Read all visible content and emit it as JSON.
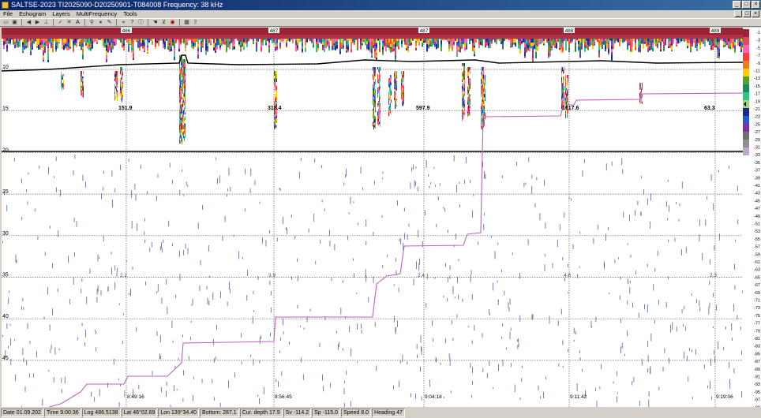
{
  "window": {
    "title": "SALTSE-2023  TI2025090-D20250901-T084008  Frequency: 38 kHz",
    "buttons": [
      "_",
      "□",
      "×"
    ]
  },
  "menu": {
    "items": [
      "File",
      "Echogram",
      "Layers",
      "MultiFrequency",
      "Tools"
    ],
    "mdi_buttons": [
      "_",
      "□",
      "×"
    ]
  },
  "toolbar": {
    "icons": [
      "open-icon",
      "save-icon",
      "back-icon",
      "forward-icon",
      "measure-icon",
      "check-icon",
      "layer-tool-icon",
      "letter-a-icon",
      "zoom-icon",
      "color-icon",
      "pen-icon",
      "pan-icon",
      "help-icon",
      "info-icon",
      "hand-icon",
      "bottom-icon",
      "eye-icon",
      "grid-icon",
      "export-icon"
    ]
  },
  "echogram": {
    "depth_labels": [
      "10",
      "15",
      "20",
      "25",
      "30",
      "35",
      "40",
      "45"
    ],
    "log_labels": [
      "486",
      "487",
      "487",
      "488",
      "489"
    ],
    "value_labels_top": [
      "151.9",
      "318.4",
      "597.9",
      "1017.6",
      "63.3"
    ],
    "value_labels_mid": [
      "2.2",
      "3.9",
      "2.4",
      "4.8",
      "2.3"
    ],
    "time_labels": [
      "8:49:16",
      "8:56:45",
      "9:04:18",
      "9:11:42",
      "9:19:06"
    ],
    "colors": {
      "top_band": "#9b2335",
      "integration_line": "#c060c0",
      "bottom_line": "#000000",
      "noise": "#1a2a80"
    }
  },
  "scale": {
    "labels": [
      "-1",
      "-3",
      "-5",
      "-7",
      "-9",
      "-11",
      "-13",
      "-15",
      "-17",
      "-19",
      "-21",
      "-23",
      "-25",
      "-27",
      "-29",
      "-31",
      "-33",
      "-35",
      "-37",
      "-39",
      "-41",
      "-43",
      "-45",
      "-47",
      "-49",
      "-51",
      "-53",
      "-55",
      "-57",
      "-59",
      "-61",
      "-63",
      "-65",
      "-67",
      "-69",
      "-71",
      "-73",
      "-75",
      "-77",
      "-79",
      "-81",
      "-83",
      "-85",
      "-87",
      "-89",
      "-91",
      "-93",
      "-95",
      "-97",
      "-99"
    ],
    "colors": [
      "#9b2335",
      "#e04a5a",
      "#ff66aa",
      "#ff3b3b",
      "#f07a20",
      "#ffcc00",
      "#58a028",
      "#1c8a5a",
      "#30c88a",
      "#a0d870",
      "#1a2a9a",
      "#2a5ad0",
      "#8030a0",
      "#707070",
      "#909090",
      "#c0a8c8"
    ]
  },
  "status": {
    "fields": [
      {
        "label": "Date",
        "value": "01.09.202"
      },
      {
        "label": "Time",
        "value": "9:00:36"
      },
      {
        "label": "Log",
        "value": "486.5138"
      },
      {
        "label": "Lat",
        "value": "46°02.69"
      },
      {
        "label": "Lon",
        "value": "139°34.40"
      },
      {
        "label": "Bottom:",
        "value": "287.1"
      },
      {
        "label": "Cur. depth",
        "value": "17.9"
      },
      {
        "label": "Sv",
        "value": "-114.2"
      },
      {
        "label": "Sp",
        "value": "-115.0"
      },
      {
        "label": "Speed",
        "value": "8.0"
      },
      {
        "label": "Heading",
        "value": "47"
      }
    ]
  }
}
